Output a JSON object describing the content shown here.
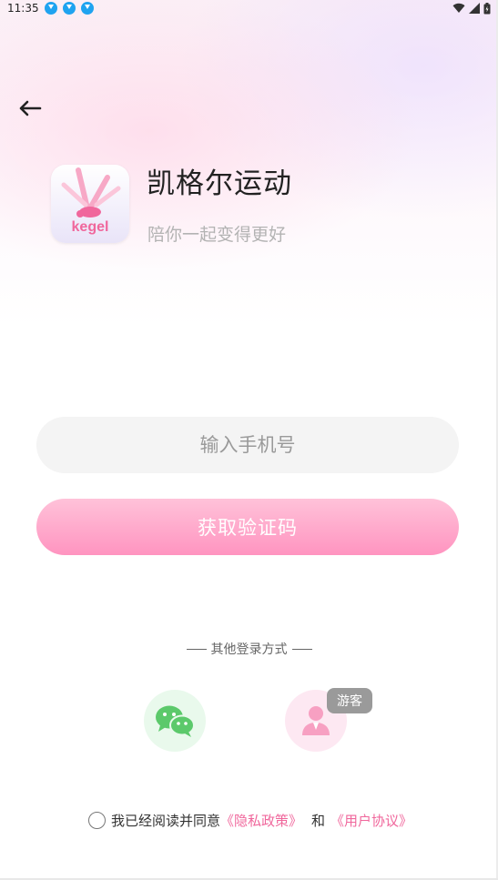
{
  "status_bar": {
    "time": "11:35",
    "download_icons": [
      "download-icon",
      "download-icon",
      "download-icon"
    ],
    "right_icons": [
      "wifi-icon",
      "signal-icon",
      "battery-icon"
    ]
  },
  "header": {
    "back_icon": "arrow-left-icon"
  },
  "app": {
    "logo_text": "kegel",
    "title": "凯格尔运动",
    "subtitle": "陪你一起变得更好",
    "accent_color": "#f0679c"
  },
  "form": {
    "phone_placeholder": "输入手机号",
    "phone_value": "",
    "get_code_label": "获取验证码",
    "button_color": "#ff9cc4"
  },
  "other_login": {
    "label": "其他登录方式",
    "wechat_icon": "wechat-icon",
    "guest_icon": "user-icon",
    "guest_badge": "游客"
  },
  "agreement": {
    "checked": false,
    "prefix": "我已经阅读并同意",
    "privacy_link": "《隐私政策》",
    "and": "和",
    "terms_link": "《用户协议》"
  }
}
